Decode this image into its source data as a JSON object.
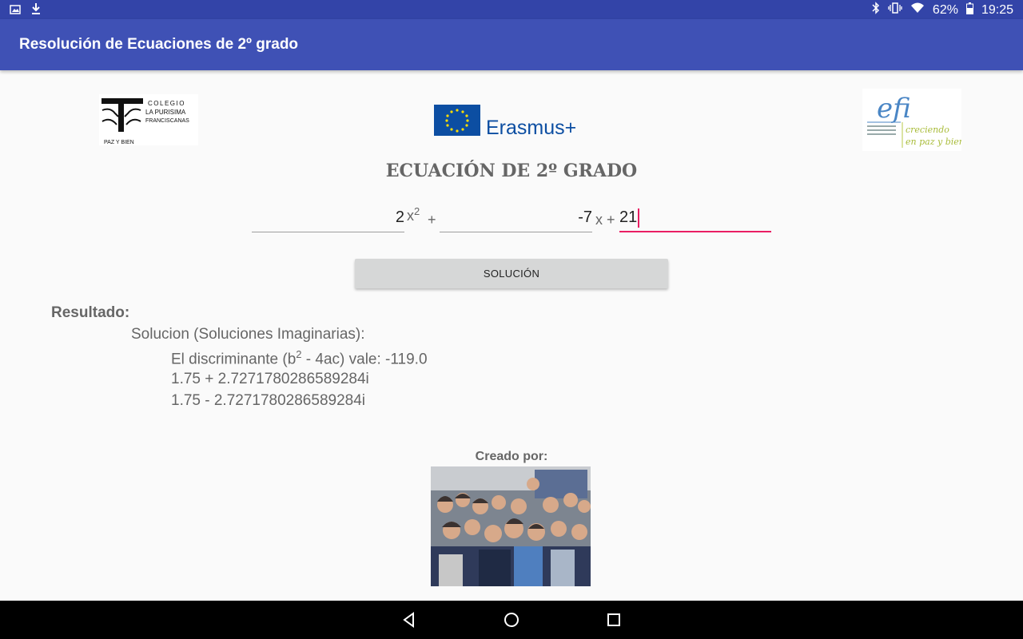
{
  "status_bar": {
    "battery": "62%",
    "time": "19:25",
    "icons": [
      "image-icon",
      "download-icon",
      "bluetooth-icon",
      "vibrate-icon",
      "wifi-icon",
      "battery-icon"
    ]
  },
  "app": {
    "title": "Resolución de Ecuaciones de 2º grado",
    "accent": "#3f51b5"
  },
  "logos": {
    "left_line1": "COLEGIO",
    "left_line2": "LA PURISIMA",
    "left_line3": "FRANCISCANAS",
    "left_motto": "PAZ Y BIEN",
    "erasmus": "Erasmus+",
    "efi_mark": "efi",
    "efi_motto_1": "creciendo",
    "efi_motto_2": "en paz y bien"
  },
  "heading": "ECUACIÓN DE 2º GRADO",
  "equation": {
    "a": "2",
    "x2_label": "x",
    "x2_exp": "2",
    "plus1": "+",
    "b": "-7",
    "x_label": "x",
    "plus2": "+",
    "c": "21"
  },
  "button": {
    "label": "SOLUCIÓN"
  },
  "result": {
    "label": "Resultado:",
    "type_line": "Solucion (Soluciones Imaginarias):",
    "disc_pre": "El discriminante (b",
    "disc_exp": "2",
    "disc_post": " - 4ac) vale: -119.0",
    "root1": "1.75 + 2.7271780286589284i",
    "root2": "1.75 - 2.7271780286589284i"
  },
  "creado_por": "Creado por:"
}
